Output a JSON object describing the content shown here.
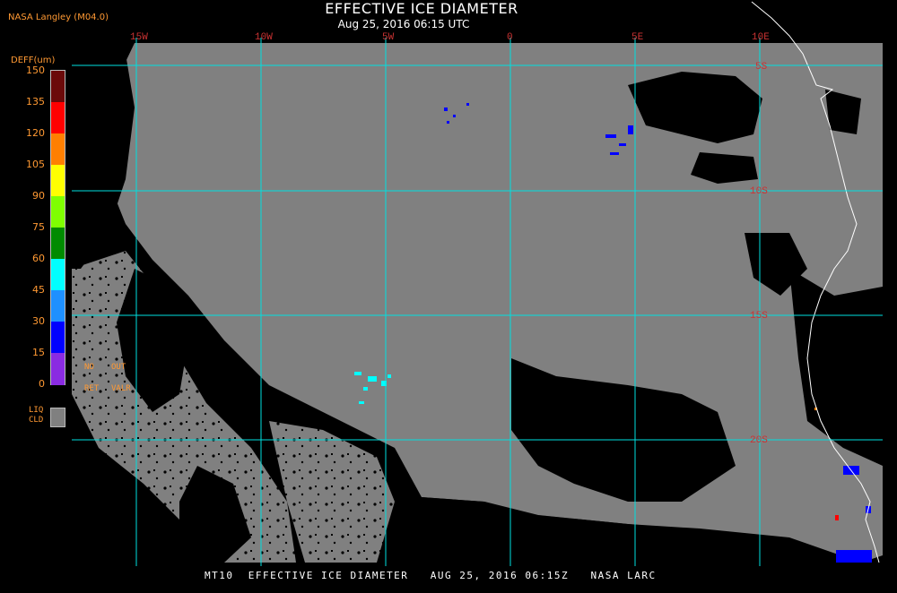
{
  "header": {
    "title": "EFFECTIVE ICE DIAMETER",
    "subtitle": "Aug 25, 2016 06:15 UTC",
    "source": "NASA Langley (M04.0)"
  },
  "legend": {
    "title": "DEFF(um)",
    "ticks": [
      "150",
      "135",
      "120",
      "105",
      "90",
      "75",
      "60",
      "45",
      "30",
      "15",
      "0"
    ],
    "colors": [
      "#6b0a0a",
      "#ff0000",
      "#ff7f00",
      "#ffff00",
      "#7fff00",
      "#008b00",
      "#00ffff",
      "#1e90ff",
      "#0000ff",
      "#8a2be2"
    ],
    "no_data_labels": [
      "NO",
      "OUT",
      "RET",
      "VALR"
    ],
    "liquid_cloud": [
      "LIQ",
      "CLD"
    ],
    "liquid_cloud_color": "#808080"
  },
  "map": {
    "longitude_labels": [
      "15W",
      "10W",
      "5W",
      "0",
      "5E",
      "10E"
    ],
    "latitude_labels": [
      "5S",
      "10S",
      "15S",
      "20S"
    ],
    "gridline_color": "#00e0e0",
    "label_color": "#cc3333",
    "cloud_color": "#808080",
    "coast_color": "#ffffff"
  },
  "footer": {
    "text": "MT10  EFFECTIVE ICE DIAMETER   AUG 25, 2016 06:15Z   NASA LARC"
  }
}
